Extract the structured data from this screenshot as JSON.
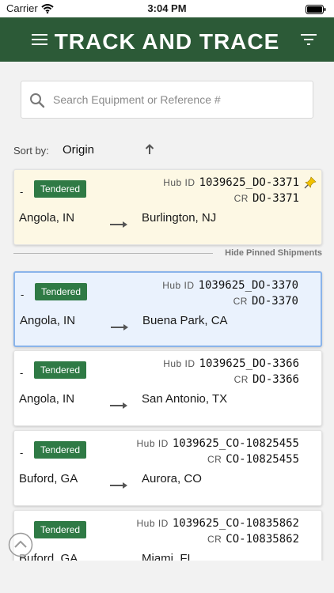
{
  "status_bar": {
    "carrier": "Carrier",
    "time": "3:04 PM"
  },
  "header": {
    "title": "TRACK AND TRACE"
  },
  "search": {
    "placeholder": "Search Equipment or Reference #"
  },
  "sort": {
    "label": "Sort by:",
    "value": "Origin"
  },
  "divider": {
    "label": "Hide Pinned Shipments"
  },
  "labels": {
    "hub": "Hub ID",
    "cr": "CR"
  },
  "colors": {
    "header": "#2c5a37",
    "badge": "#2f7a45",
    "pinned_bg": "#fdf8e4",
    "selected_bg": "#eaf2fd",
    "selected_border": "#8ab4ea",
    "pin": "#f2c200"
  },
  "icons": [
    "menu-icon",
    "filter-icon",
    "search-icon",
    "sort-arrow-icon",
    "pin-icon",
    "route-arrow-icon",
    "scroll-top-icon",
    "wifi-icon",
    "battery-icon"
  ],
  "shipments": [
    {
      "dash": "-",
      "status": "Tendered",
      "hub_id": "1039625_DO-3371",
      "cr": "DO-3371",
      "origin": "Angola, IN",
      "destination": "Burlington, NJ",
      "pinned": true
    },
    {
      "dash": "-",
      "status": "Tendered",
      "hub_id": "1039625_DO-3370",
      "cr": "DO-3370",
      "origin": "Angola, IN",
      "destination": "Buena Park, CA",
      "selected": true
    },
    {
      "dash": "-",
      "status": "Tendered",
      "hub_id": "1039625_DO-3366",
      "cr": "DO-3366",
      "origin": "Angola, IN",
      "destination": "San Antonio, TX"
    },
    {
      "dash": "-",
      "status": "Tendered",
      "hub_id": "1039625_CO-10825455",
      "cr": "CO-10825455",
      "origin": "Buford, GA",
      "destination": "Aurora, CO"
    },
    {
      "dash": "-",
      "status": "Tendered",
      "hub_id": "1039625_CO-10835862",
      "cr": "CO-10835862",
      "origin": "Buford, GA",
      "destination": "Miami, FL"
    }
  ]
}
